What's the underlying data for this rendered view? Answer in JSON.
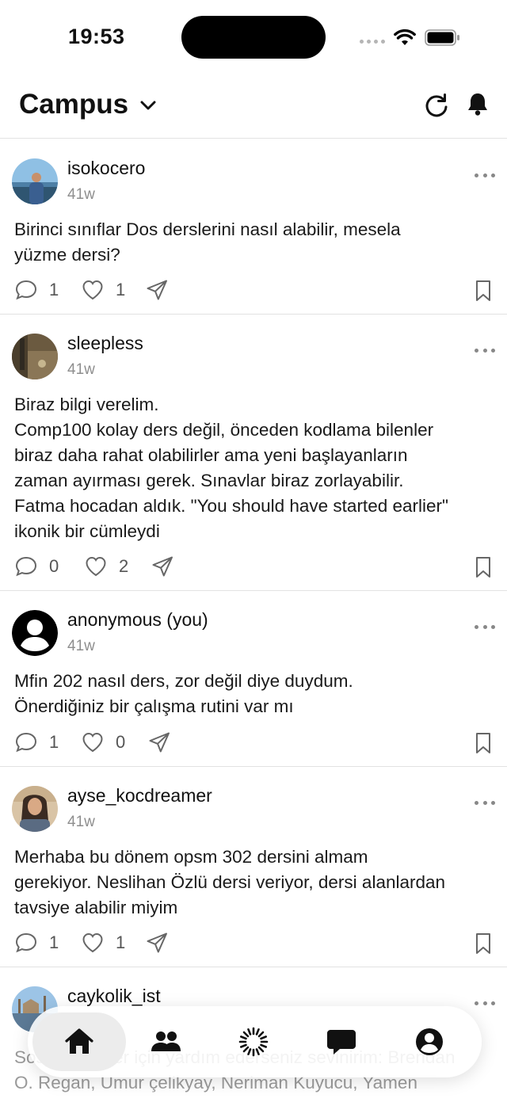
{
  "status": {
    "time": "19:53"
  },
  "header": {
    "title": "Campus"
  },
  "posts": [
    {
      "username": "isokocero",
      "time": "41w",
      "text": "Birinci sınıflar Dos derslerini nasıl alabilir, mesela\nyüzme dersi?",
      "comments": "1",
      "likes": "1"
    },
    {
      "username": "sleepless",
      "time": "41w",
      "text": "Biraz bilgi verelim.\nComp100 kolay ders değil, önceden kodlama bilenler\nbiraz daha rahat olabilirler ama yeni başlayanların\nzaman ayırması gerek. Sınavlar biraz zorlayabilir.\nFatma hocadan aldık. \"You should have started earlier\"\nikonik bir cümleydi",
      "comments": "0",
      "likes": "2"
    },
    {
      "username": "anonymous (you)",
      "time": "41w",
      "text": "Mfin 202 nasıl ders, zor değil diye duydum.\nÖnerdiğiniz bir çalışma rutini var mı",
      "comments": "1",
      "likes": "0"
    },
    {
      "username": "ayse_kocdreamer",
      "time": "41w",
      "text": "Merhaba bu dönem opsm 302 dersini almam\ngerekiyor. Neslihan Özlü dersi veriyor, dersi alanlardan\ntavsiye alabilir miyim",
      "comments": "1",
      "likes": "1"
    },
    {
      "username": "caykolik_ist",
      "time": "",
      "text": "Sosyal bilimler için yardım ederseniz sevinirim: Brendan\nO. Regan, Umur çelikyay, Neriman Kuyucu, Yamen",
      "comments": "",
      "likes": ""
    }
  ],
  "tabbar": {
    "active": "home",
    "items": [
      "home-icon",
      "people-icon",
      "spinner-icon",
      "chat-icon",
      "profile-icon"
    ]
  },
  "colors": {
    "text": "#111111",
    "muted": "#8e8e8e",
    "divider": "#e2e2e2",
    "icon": "#666666"
  }
}
